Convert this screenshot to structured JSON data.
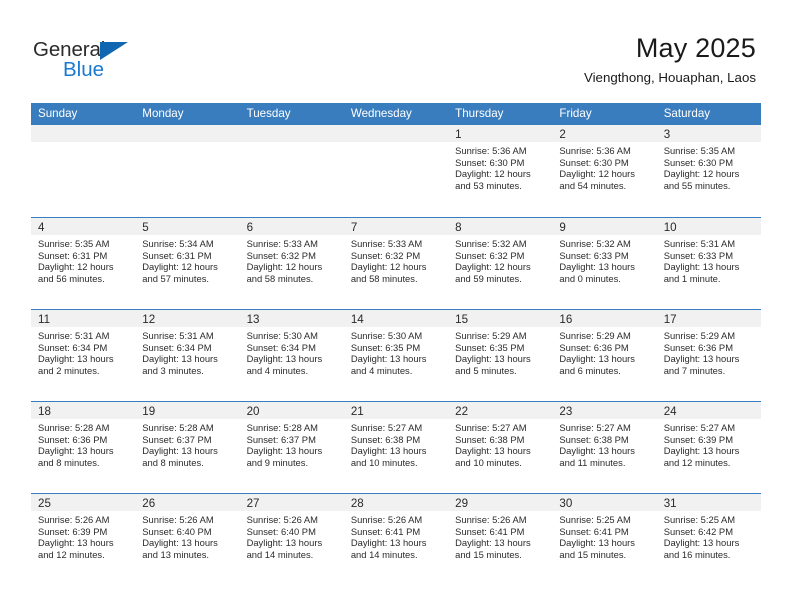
{
  "brand": {
    "name_top": "General",
    "name_bottom": "Blue",
    "accent_color": "#1b79d0",
    "triangle_color": "#1066b0"
  },
  "header": {
    "title": "May 2025",
    "location": "Viengthong, Houaphan, Laos"
  },
  "calendar": {
    "header_bg": "#3a7dbf",
    "daynum_bg": "#f1f1f1",
    "weekdays": [
      "Sunday",
      "Monday",
      "Tuesday",
      "Wednesday",
      "Thursday",
      "Friday",
      "Saturday"
    ],
    "weeks": [
      [
        {
          "day": "",
          "sunrise": "",
          "sunset": "",
          "daylight_line1": "",
          "daylight_line2": "",
          "empty": true
        },
        {
          "day": "",
          "sunrise": "",
          "sunset": "",
          "daylight_line1": "",
          "daylight_line2": "",
          "empty": true
        },
        {
          "day": "",
          "sunrise": "",
          "sunset": "",
          "daylight_line1": "",
          "daylight_line2": "",
          "empty": true
        },
        {
          "day": "",
          "sunrise": "",
          "sunset": "",
          "daylight_line1": "",
          "daylight_line2": "",
          "empty": true
        },
        {
          "day": "1",
          "sunrise": "Sunrise: 5:36 AM",
          "sunset": "Sunset: 6:30 PM",
          "daylight_line1": "Daylight: 12 hours",
          "daylight_line2": "and 53 minutes."
        },
        {
          "day": "2",
          "sunrise": "Sunrise: 5:36 AM",
          "sunset": "Sunset: 6:30 PM",
          "daylight_line1": "Daylight: 12 hours",
          "daylight_line2": "and 54 minutes."
        },
        {
          "day": "3",
          "sunrise": "Sunrise: 5:35 AM",
          "sunset": "Sunset: 6:30 PM",
          "daylight_line1": "Daylight: 12 hours",
          "daylight_line2": "and 55 minutes."
        }
      ],
      [
        {
          "day": "4",
          "sunrise": "Sunrise: 5:35 AM",
          "sunset": "Sunset: 6:31 PM",
          "daylight_line1": "Daylight: 12 hours",
          "daylight_line2": "and 56 minutes."
        },
        {
          "day": "5",
          "sunrise": "Sunrise: 5:34 AM",
          "sunset": "Sunset: 6:31 PM",
          "daylight_line1": "Daylight: 12 hours",
          "daylight_line2": "and 57 minutes."
        },
        {
          "day": "6",
          "sunrise": "Sunrise: 5:33 AM",
          "sunset": "Sunset: 6:32 PM",
          "daylight_line1": "Daylight: 12 hours",
          "daylight_line2": "and 58 minutes."
        },
        {
          "day": "7",
          "sunrise": "Sunrise: 5:33 AM",
          "sunset": "Sunset: 6:32 PM",
          "daylight_line1": "Daylight: 12 hours",
          "daylight_line2": "and 58 minutes."
        },
        {
          "day": "8",
          "sunrise": "Sunrise: 5:32 AM",
          "sunset": "Sunset: 6:32 PM",
          "daylight_line1": "Daylight: 12 hours",
          "daylight_line2": "and 59 minutes."
        },
        {
          "day": "9",
          "sunrise": "Sunrise: 5:32 AM",
          "sunset": "Sunset: 6:33 PM",
          "daylight_line1": "Daylight: 13 hours",
          "daylight_line2": "and 0 minutes."
        },
        {
          "day": "10",
          "sunrise": "Sunrise: 5:31 AM",
          "sunset": "Sunset: 6:33 PM",
          "daylight_line1": "Daylight: 13 hours",
          "daylight_line2": "and 1 minute."
        }
      ],
      [
        {
          "day": "11",
          "sunrise": "Sunrise: 5:31 AM",
          "sunset": "Sunset: 6:34 PM",
          "daylight_line1": "Daylight: 13 hours",
          "daylight_line2": "and 2 minutes."
        },
        {
          "day": "12",
          "sunrise": "Sunrise: 5:31 AM",
          "sunset": "Sunset: 6:34 PM",
          "daylight_line1": "Daylight: 13 hours",
          "daylight_line2": "and 3 minutes."
        },
        {
          "day": "13",
          "sunrise": "Sunrise: 5:30 AM",
          "sunset": "Sunset: 6:34 PM",
          "daylight_line1": "Daylight: 13 hours",
          "daylight_line2": "and 4 minutes."
        },
        {
          "day": "14",
          "sunrise": "Sunrise: 5:30 AM",
          "sunset": "Sunset: 6:35 PM",
          "daylight_line1": "Daylight: 13 hours",
          "daylight_line2": "and 4 minutes."
        },
        {
          "day": "15",
          "sunrise": "Sunrise: 5:29 AM",
          "sunset": "Sunset: 6:35 PM",
          "daylight_line1": "Daylight: 13 hours",
          "daylight_line2": "and 5 minutes."
        },
        {
          "day": "16",
          "sunrise": "Sunrise: 5:29 AM",
          "sunset": "Sunset: 6:36 PM",
          "daylight_line1": "Daylight: 13 hours",
          "daylight_line2": "and 6 minutes."
        },
        {
          "day": "17",
          "sunrise": "Sunrise: 5:29 AM",
          "sunset": "Sunset: 6:36 PM",
          "daylight_line1": "Daylight: 13 hours",
          "daylight_line2": "and 7 minutes."
        }
      ],
      [
        {
          "day": "18",
          "sunrise": "Sunrise: 5:28 AM",
          "sunset": "Sunset: 6:36 PM",
          "daylight_line1": "Daylight: 13 hours",
          "daylight_line2": "and 8 minutes."
        },
        {
          "day": "19",
          "sunrise": "Sunrise: 5:28 AM",
          "sunset": "Sunset: 6:37 PM",
          "daylight_line1": "Daylight: 13 hours",
          "daylight_line2": "and 8 minutes."
        },
        {
          "day": "20",
          "sunrise": "Sunrise: 5:28 AM",
          "sunset": "Sunset: 6:37 PM",
          "daylight_line1": "Daylight: 13 hours",
          "daylight_line2": "and 9 minutes."
        },
        {
          "day": "21",
          "sunrise": "Sunrise: 5:27 AM",
          "sunset": "Sunset: 6:38 PM",
          "daylight_line1": "Daylight: 13 hours",
          "daylight_line2": "and 10 minutes."
        },
        {
          "day": "22",
          "sunrise": "Sunrise: 5:27 AM",
          "sunset": "Sunset: 6:38 PM",
          "daylight_line1": "Daylight: 13 hours",
          "daylight_line2": "and 10 minutes."
        },
        {
          "day": "23",
          "sunrise": "Sunrise: 5:27 AM",
          "sunset": "Sunset: 6:38 PM",
          "daylight_line1": "Daylight: 13 hours",
          "daylight_line2": "and 11 minutes."
        },
        {
          "day": "24",
          "sunrise": "Sunrise: 5:27 AM",
          "sunset": "Sunset: 6:39 PM",
          "daylight_line1": "Daylight: 13 hours",
          "daylight_line2": "and 12 minutes."
        }
      ],
      [
        {
          "day": "25",
          "sunrise": "Sunrise: 5:26 AM",
          "sunset": "Sunset: 6:39 PM",
          "daylight_line1": "Daylight: 13 hours",
          "daylight_line2": "and 12 minutes."
        },
        {
          "day": "26",
          "sunrise": "Sunrise: 5:26 AM",
          "sunset": "Sunset: 6:40 PM",
          "daylight_line1": "Daylight: 13 hours",
          "daylight_line2": "and 13 minutes."
        },
        {
          "day": "27",
          "sunrise": "Sunrise: 5:26 AM",
          "sunset": "Sunset: 6:40 PM",
          "daylight_line1": "Daylight: 13 hours",
          "daylight_line2": "and 14 minutes."
        },
        {
          "day": "28",
          "sunrise": "Sunrise: 5:26 AM",
          "sunset": "Sunset: 6:41 PM",
          "daylight_line1": "Daylight: 13 hours",
          "daylight_line2": "and 14 minutes."
        },
        {
          "day": "29",
          "sunrise": "Sunrise: 5:26 AM",
          "sunset": "Sunset: 6:41 PM",
          "daylight_line1": "Daylight: 13 hours",
          "daylight_line2": "and 15 minutes."
        },
        {
          "day": "30",
          "sunrise": "Sunrise: 5:25 AM",
          "sunset": "Sunset: 6:41 PM",
          "daylight_line1": "Daylight: 13 hours",
          "daylight_line2": "and 15 minutes."
        },
        {
          "day": "31",
          "sunrise": "Sunrise: 5:25 AM",
          "sunset": "Sunset: 6:42 PM",
          "daylight_line1": "Daylight: 13 hours",
          "daylight_line2": "and 16 minutes."
        }
      ]
    ]
  }
}
